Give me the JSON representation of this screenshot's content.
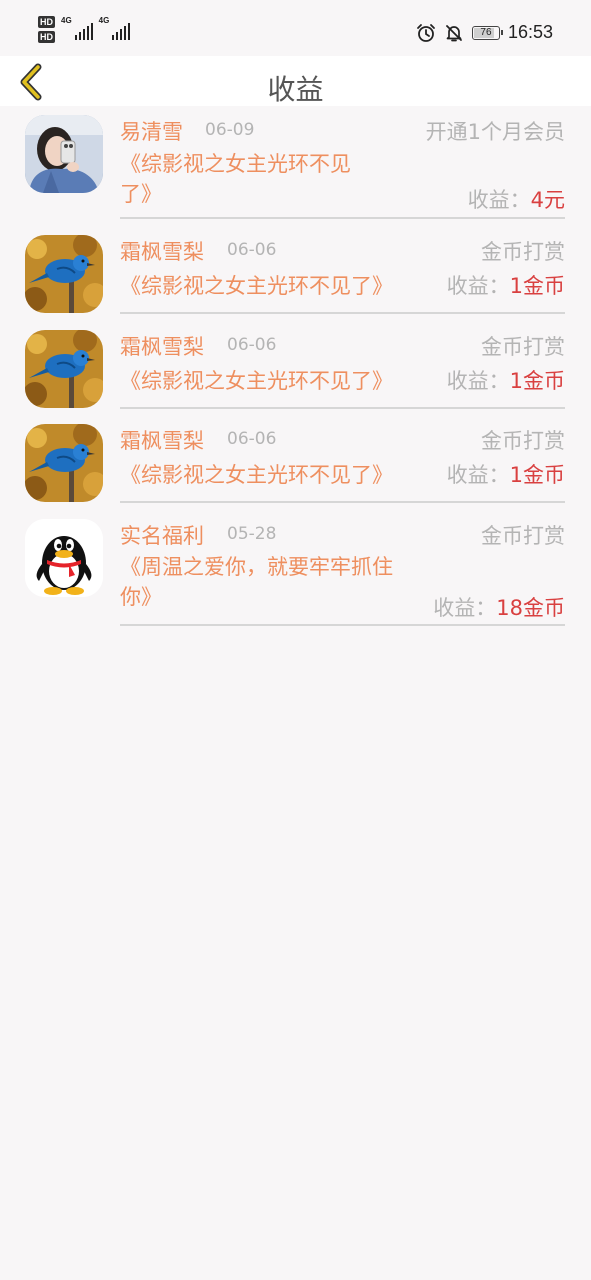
{
  "status_bar": {
    "hd1": "HD",
    "hd2": "HD",
    "net1": "4G",
    "net2": "4G",
    "battery": "76",
    "time": "16:53",
    "icons": [
      "alarm-icon",
      "bell-off-icon",
      "battery-icon"
    ]
  },
  "header": {
    "title": "收益",
    "back_icon": "chevron-left-icon"
  },
  "earnings": [
    {
      "name": "易清雪",
      "date": "06-09",
      "type": "开通1个月会员",
      "book_line1": "《综影视之女主光环不见",
      "book_line2": "了》",
      "earn_label": "收益：",
      "amount": "4元",
      "avatar": "girl-photo"
    },
    {
      "name": "霜枫雪梨",
      "date": "06-06",
      "type": "金币打赏",
      "book": "《综影视之女主光环不见了》",
      "earn_label": "收益：",
      "amount": "1金币",
      "avatar": "blue-bird"
    },
    {
      "name": "霜枫雪梨",
      "date": "06-06",
      "type": "金币打赏",
      "book": "《综影视之女主光环不见了》",
      "earn_label": "收益：",
      "amount": "1金币",
      "avatar": "blue-bird"
    },
    {
      "name": "霜枫雪梨",
      "date": "06-06",
      "type": "金币打赏",
      "book": "《综影视之女主光环不见了》",
      "earn_label": "收益：",
      "amount": "1金币",
      "avatar": "blue-bird"
    },
    {
      "name": "实名福利",
      "date": "05-28",
      "type": "金币打赏",
      "book_line1": "《周温之爱你，就要牢牢抓住",
      "book_line2": "你》",
      "earn_label": "收益：",
      "amount": "18金币",
      "avatar": "qq-penguin"
    }
  ],
  "colors": {
    "accent_orange": "#ee8f5f",
    "amount_red": "#d94040",
    "muted_gray": "#b4b4b4",
    "back_icon_yellow": "#e0c020"
  }
}
